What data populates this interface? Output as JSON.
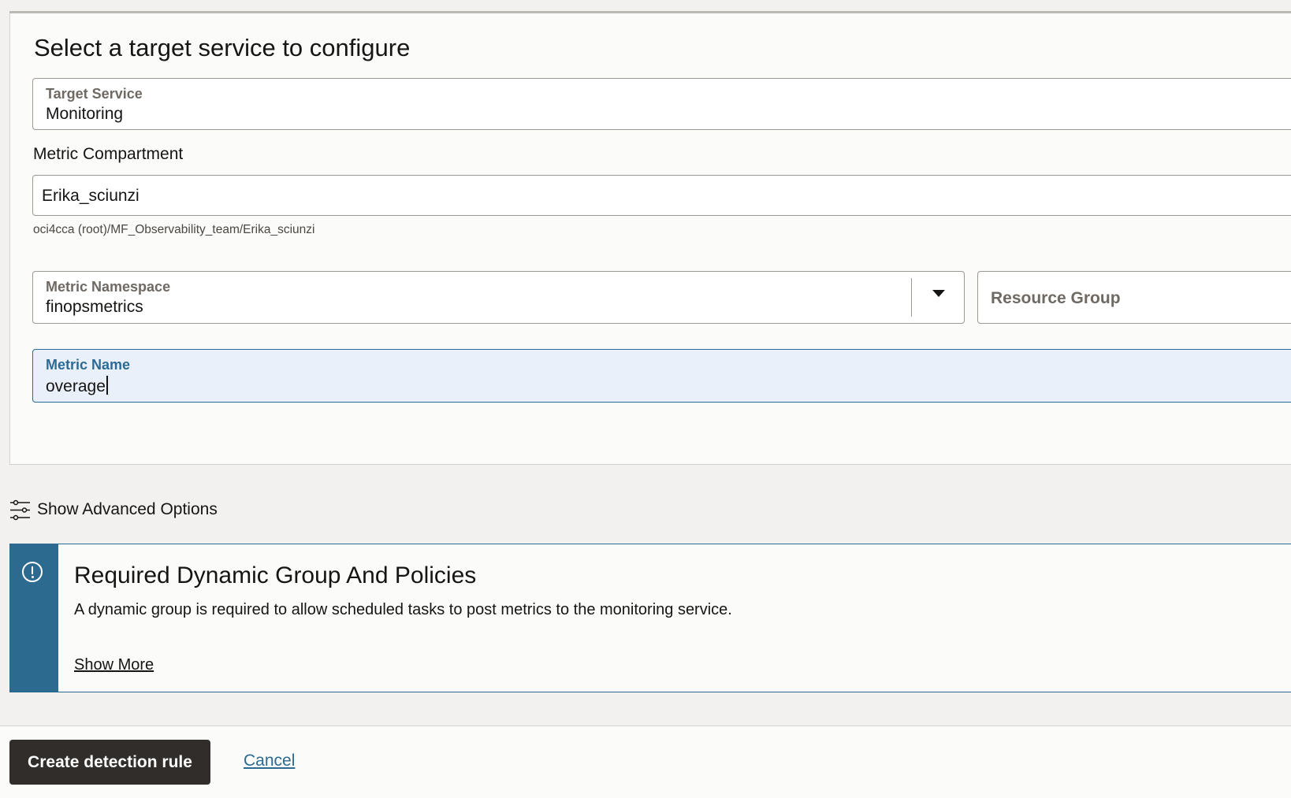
{
  "section": {
    "title": "Select a target service to configure"
  },
  "target_service": {
    "label": "Target Service",
    "value": "Monitoring"
  },
  "metric_compartment": {
    "label": "Metric Compartment",
    "value": "Erika_sciunzi",
    "path_hint": "oci4cca (root)/MF_Observability_team/Erika_sciunzi"
  },
  "metric_namespace": {
    "label": "Metric Namespace",
    "value": "finopsmetrics",
    "icon": "chevron-down-icon"
  },
  "resource_group": {
    "placeholder": "Resource Group"
  },
  "metric_name": {
    "label": "Metric Name",
    "value": "overage"
  },
  "advanced": {
    "label": "Show Advanced Options",
    "icon": "sliders-icon"
  },
  "banner": {
    "icon": "info-exclamation-icon",
    "title": "Required Dynamic Group And Policies",
    "text": "A dynamic group is required to allow scheduled tasks to post metrics to the monitoring service.",
    "link": "Show More",
    "accent_color": "#2c6a8f"
  },
  "footer": {
    "primary_label": "Create detection rule",
    "cancel_label": "Cancel"
  }
}
